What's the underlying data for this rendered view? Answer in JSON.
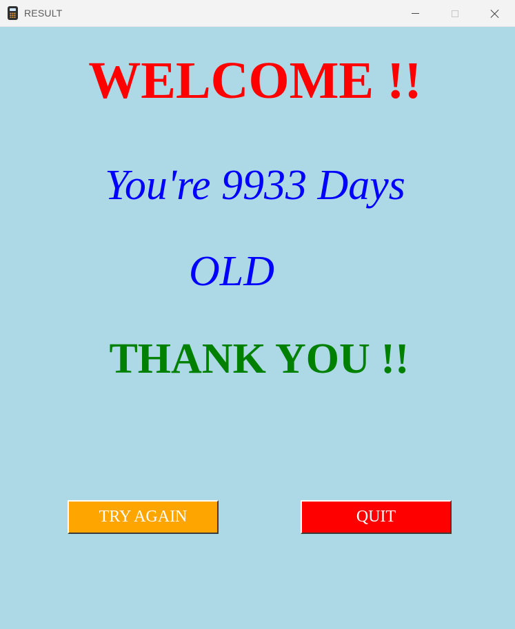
{
  "window": {
    "title": "RESULT",
    "app_icon": "calculator-icon",
    "controls": {
      "minimize_icon": "minimize-icon",
      "maximize_icon": "maximize-icon",
      "close_icon": "close-icon"
    }
  },
  "content": {
    "welcome": "WELCOME !!",
    "days_line": "You're 9933 Days",
    "old_line": "OLD",
    "thanks": "THANK YOU !!"
  },
  "buttons": {
    "try_again": "TRY AGAIN",
    "quit": "QUIT"
  },
  "colors": {
    "background": "#add8e6",
    "welcome": "#ff0000",
    "days": "#0000ff",
    "thanks": "#008000",
    "try_again_bg": "#ffa500",
    "quit_bg": "#ff0000"
  }
}
